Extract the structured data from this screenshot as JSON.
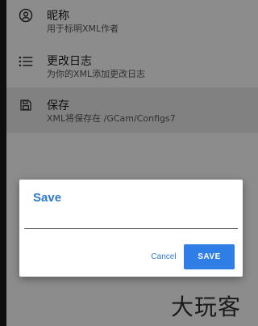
{
  "settings": {
    "items": [
      {
        "title": "昵称",
        "summary": "用于标明XML作者",
        "icon": "account-circle-icon"
      },
      {
        "title": "更改日志",
        "summary": "为你的XML添加更改日志",
        "icon": "list-icon"
      },
      {
        "title": "保存",
        "summary": "XML将保存在 /GCam/Configs7",
        "icon": "save-icon"
      }
    ]
  },
  "dialog": {
    "title": "Save",
    "input_value": "",
    "cancel_label": "Cancel",
    "save_label": "SAVE"
  },
  "watermark": "大玩客",
  "colors": {
    "accent": "#2f7ee6",
    "accent_text": "#2f79c8",
    "scrim": "rgba(0,0,0,0.45)"
  }
}
